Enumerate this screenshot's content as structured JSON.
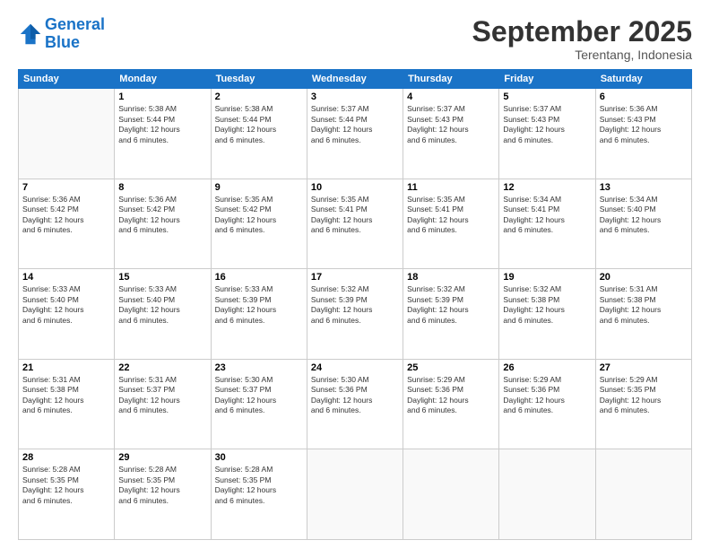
{
  "app": {
    "logo_line1": "General",
    "logo_line2": "Blue"
  },
  "header": {
    "month_title": "September 2025",
    "location": "Terentang, Indonesia"
  },
  "weekdays": [
    "Sunday",
    "Monday",
    "Tuesday",
    "Wednesday",
    "Thursday",
    "Friday",
    "Saturday"
  ],
  "weeks": [
    [
      {
        "day": "",
        "info": ""
      },
      {
        "day": "1",
        "info": "Sunrise: 5:38 AM\nSunset: 5:44 PM\nDaylight: 12 hours\nand 6 minutes."
      },
      {
        "day": "2",
        "info": "Sunrise: 5:38 AM\nSunset: 5:44 PM\nDaylight: 12 hours\nand 6 minutes."
      },
      {
        "day": "3",
        "info": "Sunrise: 5:37 AM\nSunset: 5:44 PM\nDaylight: 12 hours\nand 6 minutes."
      },
      {
        "day": "4",
        "info": "Sunrise: 5:37 AM\nSunset: 5:43 PM\nDaylight: 12 hours\nand 6 minutes."
      },
      {
        "day": "5",
        "info": "Sunrise: 5:37 AM\nSunset: 5:43 PM\nDaylight: 12 hours\nand 6 minutes."
      },
      {
        "day": "6",
        "info": "Sunrise: 5:36 AM\nSunset: 5:43 PM\nDaylight: 12 hours\nand 6 minutes."
      }
    ],
    [
      {
        "day": "7",
        "info": "Sunrise: 5:36 AM\nSunset: 5:42 PM\nDaylight: 12 hours\nand 6 minutes."
      },
      {
        "day": "8",
        "info": "Sunrise: 5:36 AM\nSunset: 5:42 PM\nDaylight: 12 hours\nand 6 minutes."
      },
      {
        "day": "9",
        "info": "Sunrise: 5:35 AM\nSunset: 5:42 PM\nDaylight: 12 hours\nand 6 minutes."
      },
      {
        "day": "10",
        "info": "Sunrise: 5:35 AM\nSunset: 5:41 PM\nDaylight: 12 hours\nand 6 minutes."
      },
      {
        "day": "11",
        "info": "Sunrise: 5:35 AM\nSunset: 5:41 PM\nDaylight: 12 hours\nand 6 minutes."
      },
      {
        "day": "12",
        "info": "Sunrise: 5:34 AM\nSunset: 5:41 PM\nDaylight: 12 hours\nand 6 minutes."
      },
      {
        "day": "13",
        "info": "Sunrise: 5:34 AM\nSunset: 5:40 PM\nDaylight: 12 hours\nand 6 minutes."
      }
    ],
    [
      {
        "day": "14",
        "info": "Sunrise: 5:33 AM\nSunset: 5:40 PM\nDaylight: 12 hours\nand 6 minutes."
      },
      {
        "day": "15",
        "info": "Sunrise: 5:33 AM\nSunset: 5:40 PM\nDaylight: 12 hours\nand 6 minutes."
      },
      {
        "day": "16",
        "info": "Sunrise: 5:33 AM\nSunset: 5:39 PM\nDaylight: 12 hours\nand 6 minutes."
      },
      {
        "day": "17",
        "info": "Sunrise: 5:32 AM\nSunset: 5:39 PM\nDaylight: 12 hours\nand 6 minutes."
      },
      {
        "day": "18",
        "info": "Sunrise: 5:32 AM\nSunset: 5:39 PM\nDaylight: 12 hours\nand 6 minutes."
      },
      {
        "day": "19",
        "info": "Sunrise: 5:32 AM\nSunset: 5:38 PM\nDaylight: 12 hours\nand 6 minutes."
      },
      {
        "day": "20",
        "info": "Sunrise: 5:31 AM\nSunset: 5:38 PM\nDaylight: 12 hours\nand 6 minutes."
      }
    ],
    [
      {
        "day": "21",
        "info": "Sunrise: 5:31 AM\nSunset: 5:38 PM\nDaylight: 12 hours\nand 6 minutes."
      },
      {
        "day": "22",
        "info": "Sunrise: 5:31 AM\nSunset: 5:37 PM\nDaylight: 12 hours\nand 6 minutes."
      },
      {
        "day": "23",
        "info": "Sunrise: 5:30 AM\nSunset: 5:37 PM\nDaylight: 12 hours\nand 6 minutes."
      },
      {
        "day": "24",
        "info": "Sunrise: 5:30 AM\nSunset: 5:36 PM\nDaylight: 12 hours\nand 6 minutes."
      },
      {
        "day": "25",
        "info": "Sunrise: 5:29 AM\nSunset: 5:36 PM\nDaylight: 12 hours\nand 6 minutes."
      },
      {
        "day": "26",
        "info": "Sunrise: 5:29 AM\nSunset: 5:36 PM\nDaylight: 12 hours\nand 6 minutes."
      },
      {
        "day": "27",
        "info": "Sunrise: 5:29 AM\nSunset: 5:35 PM\nDaylight: 12 hours\nand 6 minutes."
      }
    ],
    [
      {
        "day": "28",
        "info": "Sunrise: 5:28 AM\nSunset: 5:35 PM\nDaylight: 12 hours\nand 6 minutes."
      },
      {
        "day": "29",
        "info": "Sunrise: 5:28 AM\nSunset: 5:35 PM\nDaylight: 12 hours\nand 6 minutes."
      },
      {
        "day": "30",
        "info": "Sunrise: 5:28 AM\nSunset: 5:35 PM\nDaylight: 12 hours\nand 6 minutes."
      },
      {
        "day": "",
        "info": ""
      },
      {
        "day": "",
        "info": ""
      },
      {
        "day": "",
        "info": ""
      },
      {
        "day": "",
        "info": ""
      }
    ]
  ]
}
